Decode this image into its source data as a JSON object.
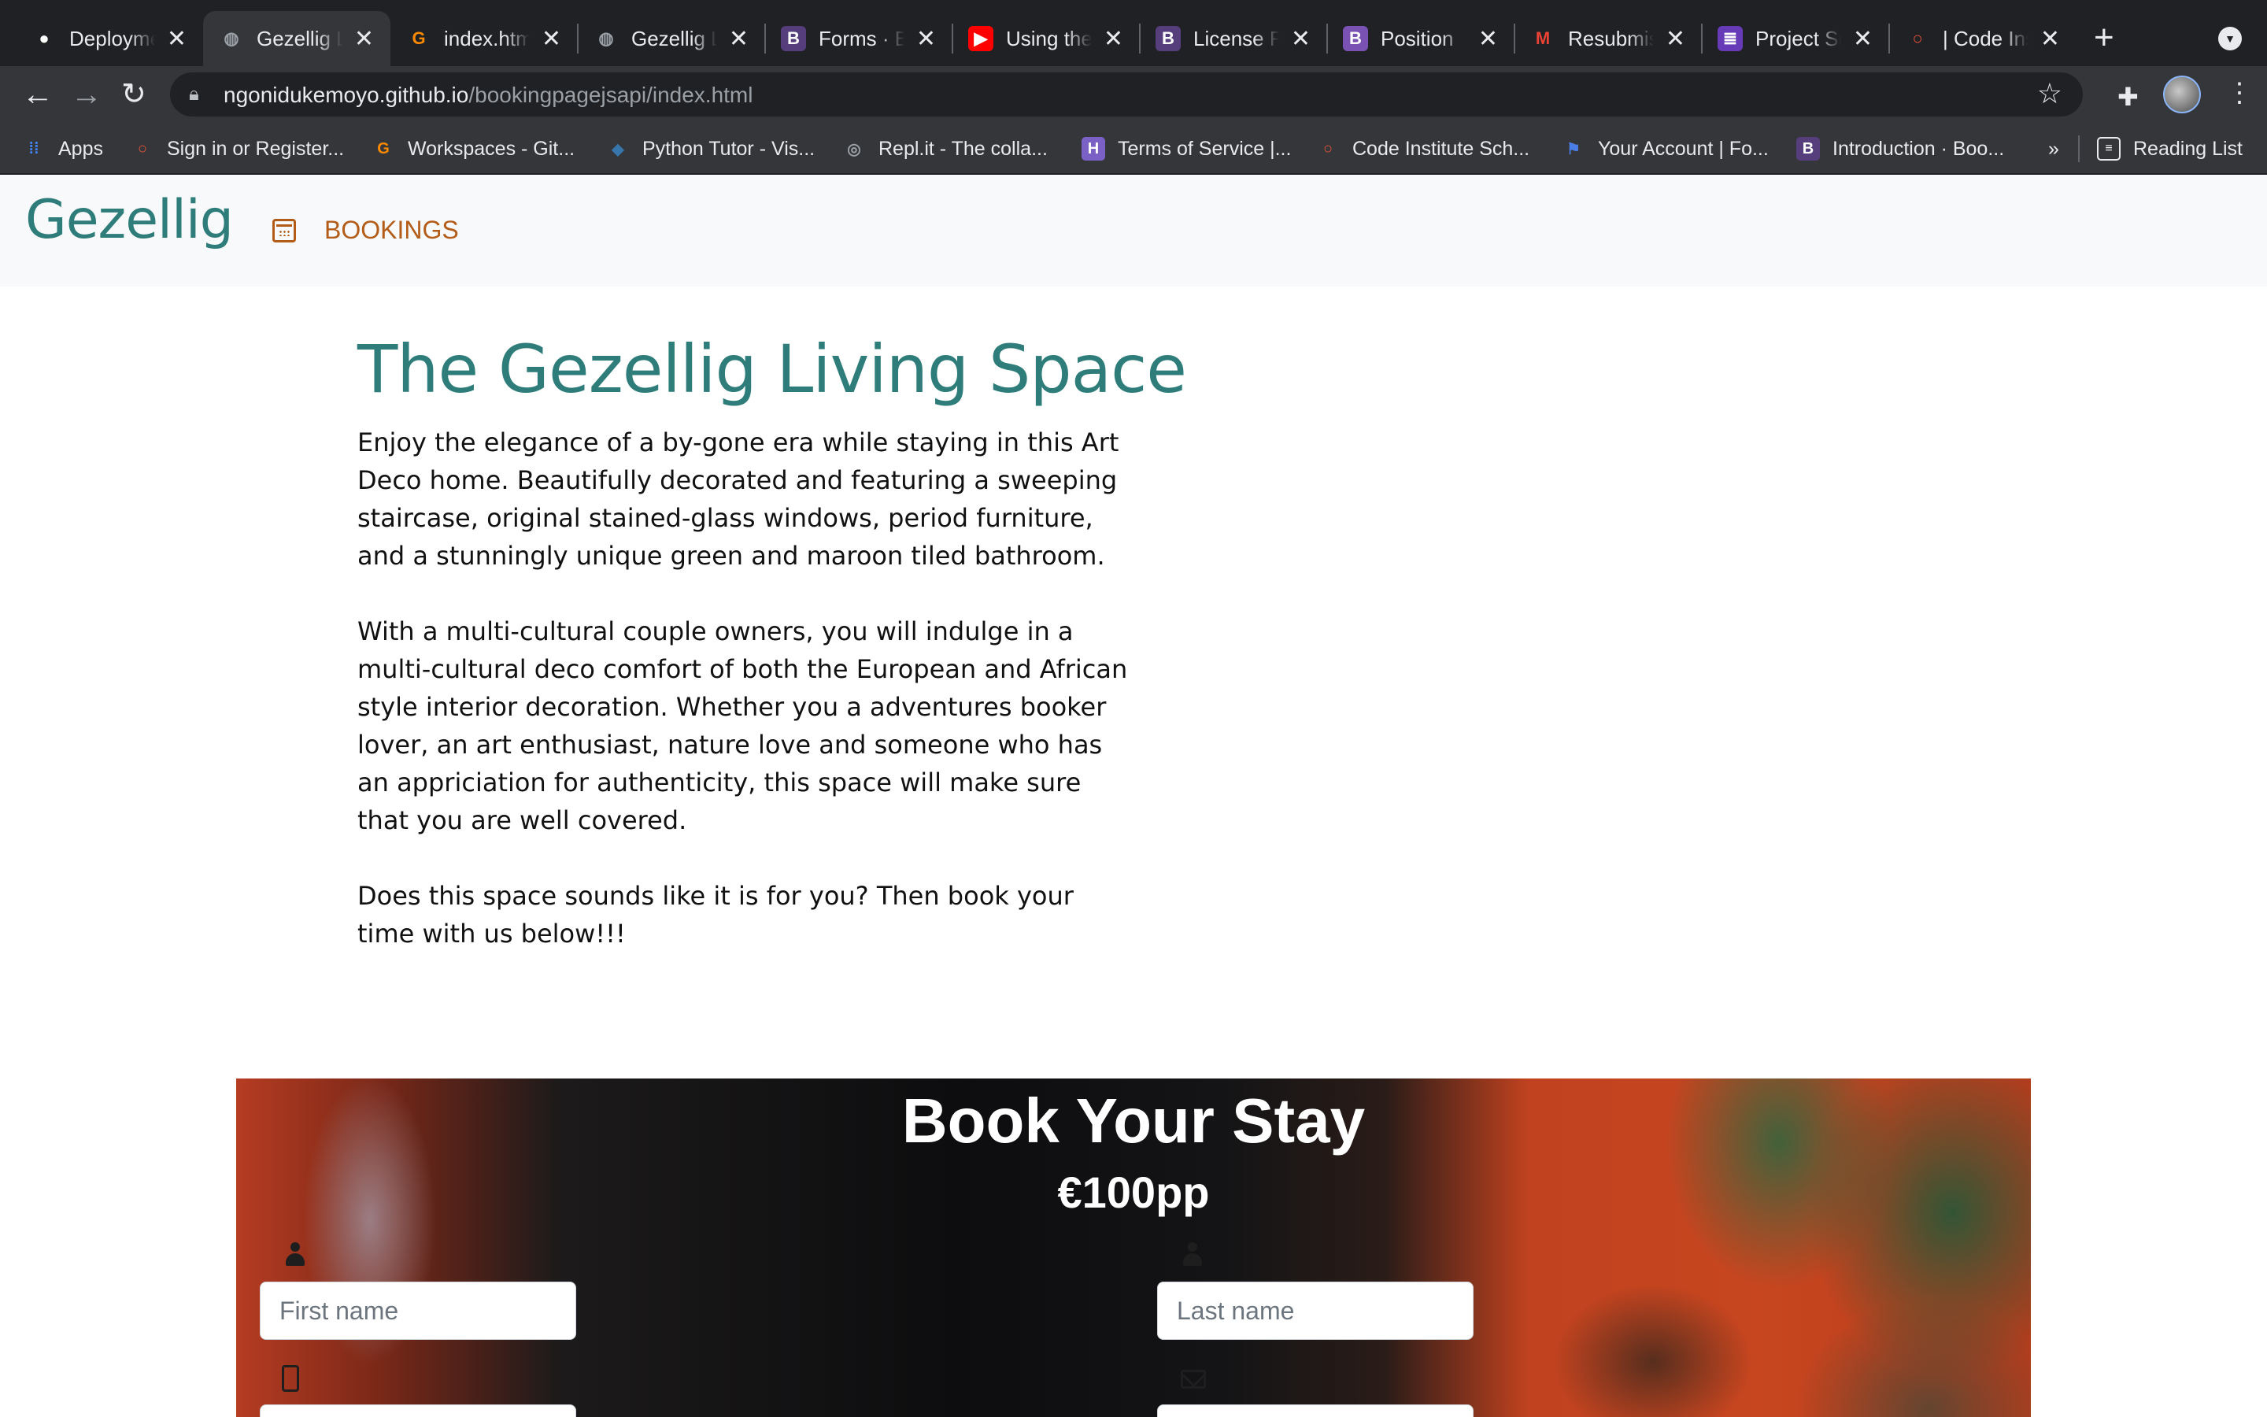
{
  "browser": {
    "tabs": [
      {
        "title": "Deployment",
        "icon": "github-icon",
        "icon_color": "#ffffff",
        "glyph": "●"
      },
      {
        "title": "Gezellig Living",
        "icon": "globe-icon",
        "icon_color": "#9aa0a6",
        "glyph": "◍"
      },
      {
        "title": "index.html",
        "icon": "gitpod-icon",
        "icon_color": "#ff8a00",
        "glyph": "G"
      },
      {
        "title": "Gezellig Living",
        "icon": "globe-icon",
        "icon_color": "#9aa0a6",
        "glyph": "◍"
      },
      {
        "title": "Forms · Bootstrap",
        "icon": "bootstrap-icon",
        "icon_color": "#563d7c",
        "glyph": "B"
      },
      {
        "title": "Using the",
        "icon": "youtube-icon",
        "icon_color": "#ff0000",
        "glyph": "▶"
      },
      {
        "title": "License File",
        "icon": "bootstrap-icon",
        "icon_color": "#563d7c",
        "glyph": "B"
      },
      {
        "title": "Position",
        "icon": "bootstrap-icon",
        "icon_color": "#7952b3",
        "glyph": "B"
      },
      {
        "title": "Resubmission",
        "icon": "gmail-icon",
        "icon_color": "#ea4335",
        "glyph": "M"
      },
      {
        "title": "Project Submission",
        "icon": "forms-icon",
        "icon_color": "#673ab7",
        "glyph": "≣"
      },
      {
        "title": "| Code Institute",
        "icon": "codeinstitute-icon",
        "icon_color": "#e8533a",
        "glyph": "○"
      }
    ],
    "close_glyph": "✕",
    "new_tab_glyph": "+",
    "url_host": "ngonidukemoyo.github.io",
    "url_path": "/bookingpagejsapi/index.html",
    "bookmarks": [
      {
        "label": "Apps",
        "icon": "apps-grid-icon",
        "color": "#4285f4",
        "glyph": "⁞⁞"
      },
      {
        "label": "Sign in or Register...",
        "icon": "codeinstitute-icon",
        "color": "#e8533a",
        "glyph": "○"
      },
      {
        "label": "Workspaces - Git...",
        "icon": "gitpod-icon",
        "color": "#ff8a00",
        "glyph": "G"
      },
      {
        "label": "Python Tutor - Vis...",
        "icon": "python-icon",
        "color": "#3776ab",
        "glyph": "◆"
      },
      {
        "label": "Repl.it - The colla...",
        "icon": "replit-icon",
        "color": "#9aa0a6",
        "glyph": "◎"
      },
      {
        "label": "Terms of Service |...",
        "icon": "heroku-icon",
        "color": "#7b61c6",
        "glyph": "H"
      },
      {
        "label": "Code Institute Sch...",
        "icon": "codeinstitute-icon",
        "color": "#e8533a",
        "glyph": "○"
      },
      {
        "label": "Your Account | Fo...",
        "icon": "flag-icon",
        "color": "#4a7ee6",
        "glyph": "⚑"
      },
      {
        "label": "Introduction · Boo...",
        "icon": "bootstrap-icon",
        "color": "#563d7c",
        "glyph": "B"
      }
    ],
    "more_bookmarks": "»",
    "reading_list": "Reading List"
  },
  "site": {
    "brand": "Gezellig",
    "nav_bookings": "BOOKINGS",
    "accent_color": "#2e7d7a",
    "nav_color": "#b35c17"
  },
  "content": {
    "title": "The Gezellig Living Space",
    "paragraphs": [
      "Enjoy the elegance of a by-gone era while staying in this Art Deco home. Beautifully decorated and featuring a sweeping staircase, original stained-glass windows, period furniture, and a stunningly unique green and maroon tiled bathroom.",
      "With a multi-cultural couple owners, you will indulge in a multi-cultural deco comfort of both the European and African style interior decoration. Whether you a adventures booker lover, an art enthusiast, nature love and someone who has an appriciation for authenticity, this space will make sure that you are well covered.",
      "Does this space sounds like it is for you? Then book your time with us below!!!"
    ]
  },
  "booking": {
    "title": "Book Your Stay",
    "price": "€100pp",
    "first_name_placeholder": "First name",
    "last_name_placeholder": "Last name"
  }
}
